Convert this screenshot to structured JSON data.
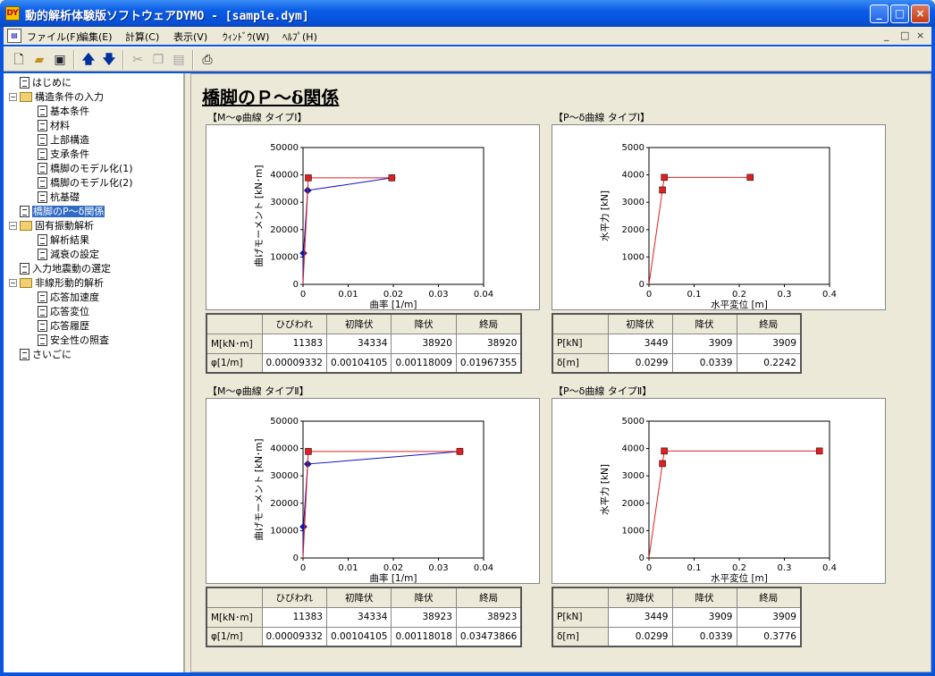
{
  "window": {
    "title": "動的解析体験版ソフトウェアDYMO - [sample.dym]",
    "icon_text": "DY"
  },
  "menu": {
    "items": [
      "ファイル(F)",
      "編集(E)",
      "計算(C)",
      "表示(V)",
      "ｳｨﾝﾄﾞｳ(W)",
      "ﾍﾙﾌﾟ(H)"
    ],
    "mdi": [
      "_",
      "□",
      "×"
    ]
  },
  "toolbar": {
    "buttons": [
      "new-file",
      "open-folder",
      "save",
      "up-arrow",
      "down-arrow",
      "cut",
      "copy",
      "paste",
      "print"
    ]
  },
  "tree": [
    {
      "label": "はじめに",
      "level": 0,
      "type": "doc"
    },
    {
      "label": "構造条件の入力",
      "level": 0,
      "type": "folder",
      "expander": "−"
    },
    {
      "label": "基本条件",
      "level": 1,
      "type": "doc"
    },
    {
      "label": "材料",
      "level": 1,
      "type": "doc"
    },
    {
      "label": "上部構造",
      "level": 1,
      "type": "doc"
    },
    {
      "label": "支承条件",
      "level": 1,
      "type": "doc"
    },
    {
      "label": "橋脚のモデル化(1)",
      "level": 1,
      "type": "doc"
    },
    {
      "label": "橋脚のモデル化(2)",
      "level": 1,
      "type": "doc"
    },
    {
      "label": "杭基礎",
      "level": 1,
      "type": "doc"
    },
    {
      "label": "橋脚のP～δ関係",
      "level": 0,
      "type": "doc",
      "selected": true
    },
    {
      "label": "固有振動解析",
      "level": 0,
      "type": "folder",
      "expander": "−"
    },
    {
      "label": "解析結果",
      "level": 1,
      "type": "doc"
    },
    {
      "label": "減衰の設定",
      "level": 1,
      "type": "doc"
    },
    {
      "label": "入力地震動の選定",
      "level": 0,
      "type": "doc"
    },
    {
      "label": "非線形動的解析",
      "level": 0,
      "type": "folder",
      "expander": "−"
    },
    {
      "label": "応答加速度",
      "level": 1,
      "type": "doc"
    },
    {
      "label": "応答変位",
      "level": 1,
      "type": "doc"
    },
    {
      "label": "応答履歴",
      "level": 1,
      "type": "doc"
    },
    {
      "label": "安全性の照査",
      "level": 1,
      "type": "doc"
    },
    {
      "label": "さいごに",
      "level": 0,
      "type": "doc"
    }
  ],
  "page": {
    "title": "橋脚のＰ～δ関係"
  },
  "panels": [
    {
      "title": "【M～φ曲線 タイプⅠ】",
      "table": {
        "headers": [
          "",
          "ひびわれ",
          "初降伏",
          "降伏",
          "終局"
        ],
        "rows": [
          [
            "M[kN･m]",
            "11383",
            "34334",
            "38920",
            "38920"
          ],
          [
            "φ[1/m]",
            "0.00009332",
            "0.00104105",
            "0.00118009",
            "0.01967355"
          ]
        ]
      }
    },
    {
      "title": "【P～δ曲線 タイプⅠ】",
      "table": {
        "headers": [
          "",
          "初降伏",
          "降伏",
          "終局"
        ],
        "rows": [
          [
            "P[kN]",
            "3449",
            "3909",
            "3909"
          ],
          [
            "δ[m]",
            "0.0299",
            "0.0339",
            "0.2242"
          ]
        ]
      }
    },
    {
      "title": "【M～φ曲線 タイプⅡ】",
      "table": {
        "headers": [
          "",
          "ひびわれ",
          "初降伏",
          "降伏",
          "終局"
        ],
        "rows": [
          [
            "M[kN･m]",
            "11383",
            "34334",
            "38923",
            "38923"
          ],
          [
            "φ[1/m]",
            "0.00009332",
            "0.00104105",
            "0.00118018",
            "0.03473866"
          ]
        ]
      }
    },
    {
      "title": "【P～δ曲線 タイプⅡ】",
      "table": {
        "headers": [
          "",
          "初降伏",
          "降伏",
          "終局"
        ],
        "rows": [
          [
            "P[kN]",
            "3449",
            "3909",
            "3909"
          ],
          [
            "δ[m]",
            "0.0299",
            "0.0339",
            "0.3776"
          ]
        ]
      }
    }
  ],
  "chart_data": [
    {
      "type": "line",
      "xlabel": "曲率 [1/m]",
      "ylabel": "曲げモーメント [kN･m]",
      "xlim": [
        0,
        0.04
      ],
      "ylim": [
        0,
        50000
      ],
      "xticks": [
        "0",
        "0.01",
        "0.02",
        "0.03",
        "0.04"
      ],
      "yticks": [
        "0",
        "10000",
        "20000",
        "30000",
        "40000",
        "50000"
      ],
      "series": [
        {
          "color": "#1010c0",
          "marker": "diamond",
          "x": [
            0,
            9.332e-05,
            0.00104105,
            0.01967355
          ],
          "y": [
            0,
            11383,
            34334,
            38920
          ]
        },
        {
          "color": "#e02020",
          "marker": "square",
          "x": [
            0,
            0.00118009,
            0.01967355
          ],
          "y": [
            0,
            38920,
            38920
          ]
        }
      ]
    },
    {
      "type": "line",
      "xlabel": "水平変位 [m]",
      "ylabel": "水平力 [kN]",
      "xlim": [
        0,
        0.4
      ],
      "ylim": [
        0,
        5000
      ],
      "xticks": [
        "0",
        "0.1",
        "0.2",
        "0.3",
        "0.4"
      ],
      "yticks": [
        "0",
        "1000",
        "2000",
        "3000",
        "4000",
        "5000"
      ],
      "series": [
        {
          "color": "#e02020",
          "marker": "square",
          "x": [
            0,
            0.0299,
            0.0339,
            0.2242
          ],
          "y": [
            0,
            3449,
            3909,
            3909
          ]
        }
      ]
    },
    {
      "type": "line",
      "xlabel": "曲率 [1/m]",
      "ylabel": "曲げモーメント [kN･m]",
      "xlim": [
        0,
        0.04
      ],
      "ylim": [
        0,
        50000
      ],
      "xticks": [
        "0",
        "0.01",
        "0.02",
        "0.03",
        "0.04"
      ],
      "yticks": [
        "0",
        "10000",
        "20000",
        "30000",
        "40000",
        "50000"
      ],
      "series": [
        {
          "color": "#1010c0",
          "marker": "diamond",
          "x": [
            0,
            9.332e-05,
            0.00104105,
            0.03473866
          ],
          "y": [
            0,
            11383,
            34334,
            38923
          ]
        },
        {
          "color": "#e02020",
          "marker": "square",
          "x": [
            0,
            0.00118018,
            0.03473866
          ],
          "y": [
            0,
            38923,
            38923
          ]
        }
      ]
    },
    {
      "type": "line",
      "xlabel": "水平変位 [m]",
      "ylabel": "水平力 [kN]",
      "xlim": [
        0,
        0.4
      ],
      "ylim": [
        0,
        5000
      ],
      "xticks": [
        "0",
        "0.1",
        "0.2",
        "0.3",
        "0.4"
      ],
      "yticks": [
        "0",
        "1000",
        "2000",
        "3000",
        "4000",
        "5000"
      ],
      "series": [
        {
          "color": "#e02020",
          "marker": "square",
          "x": [
            0,
            0.0299,
            0.0339,
            0.3776
          ],
          "y": [
            0,
            3449,
            3909,
            3909
          ]
        }
      ]
    }
  ]
}
